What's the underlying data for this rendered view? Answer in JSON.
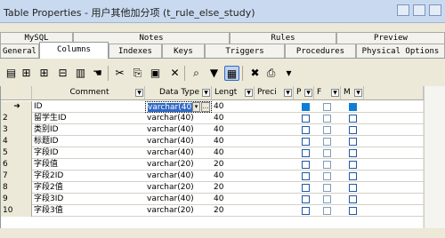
{
  "window": {
    "title": "Table Properties - 用户其他加分项 (t_rule_else_study)"
  },
  "tabs_top": [
    "MySQL",
    "Notes",
    "Rules",
    "Preview"
  ],
  "tabs_bottom": [
    "General",
    "Columns",
    "Indexes",
    "Keys",
    "Triggers",
    "Procedures",
    "Physical Options"
  ],
  "active_tab": "Columns",
  "toolbar": [
    {
      "name": "properties-icon",
      "glyph": "▤"
    },
    {
      "name": "insert-row-icon",
      "glyph": "⊞"
    },
    {
      "name": "add-row-icon",
      "glyph": "⊞"
    },
    {
      "name": "add-column-icon",
      "glyph": "⊟"
    },
    {
      "name": "import-icon",
      "glyph": "▥"
    },
    {
      "name": "pin-icon",
      "glyph": "☚"
    },
    {
      "name": "cut-icon",
      "glyph": "✂"
    },
    {
      "name": "copy-icon",
      "glyph": "⎘"
    },
    {
      "name": "paste-icon",
      "glyph": "▣"
    },
    {
      "name": "delete-icon",
      "glyph": "✕"
    },
    {
      "name": "find-icon",
      "glyph": "⌕"
    },
    {
      "name": "filter-icon",
      "glyph": "▼"
    },
    {
      "name": "customize-columns-icon",
      "glyph": "▦"
    },
    {
      "name": "excel-icon",
      "glyph": "✖"
    },
    {
      "name": "print-icon",
      "glyph": "⎙"
    },
    {
      "name": "dropdown-icon",
      "glyph": "▾"
    }
  ],
  "columns": {
    "comment": "Comment",
    "datatype": "Data Type",
    "length": "Lengt",
    "precision": "Preci",
    "p": "P",
    "f": "F",
    "m": "M"
  },
  "rows": [
    {
      "num": "➜",
      "comment": "ID",
      "type": "varchar(40)",
      "len": "40",
      "p": true,
      "m": true
    },
    {
      "num": "2",
      "comment": "留学生ID",
      "type": "varchar(40)",
      "len": "40",
      "p": false,
      "m": false
    },
    {
      "num": "3",
      "comment": "类别ID",
      "type": "varchar(40)",
      "len": "40",
      "p": false,
      "m": false
    },
    {
      "num": "4",
      "comment": "标题ID",
      "type": "varchar(40)",
      "len": "40",
      "p": false,
      "m": false
    },
    {
      "num": "5",
      "comment": "字段ID",
      "type": "varchar(40)",
      "len": "40",
      "p": false,
      "m": false
    },
    {
      "num": "6",
      "comment": "字段值",
      "type": "varchar(20)",
      "len": "20",
      "p": false,
      "m": false
    },
    {
      "num": "7",
      "comment": "字段2ID",
      "type": "varchar(40)",
      "len": "40",
      "p": false,
      "m": false
    },
    {
      "num": "8",
      "comment": "字段2值",
      "type": "varchar(20)",
      "len": "20",
      "p": false,
      "m": false
    },
    {
      "num": "9",
      "comment": "字段3ID",
      "type": "varchar(40)",
      "len": "40",
      "p": false,
      "m": false
    },
    {
      "num": "10",
      "comment": "字段3值",
      "type": "varchar(20)",
      "len": "20",
      "p": false,
      "m": false
    }
  ],
  "selected_type": "varchar(40)"
}
